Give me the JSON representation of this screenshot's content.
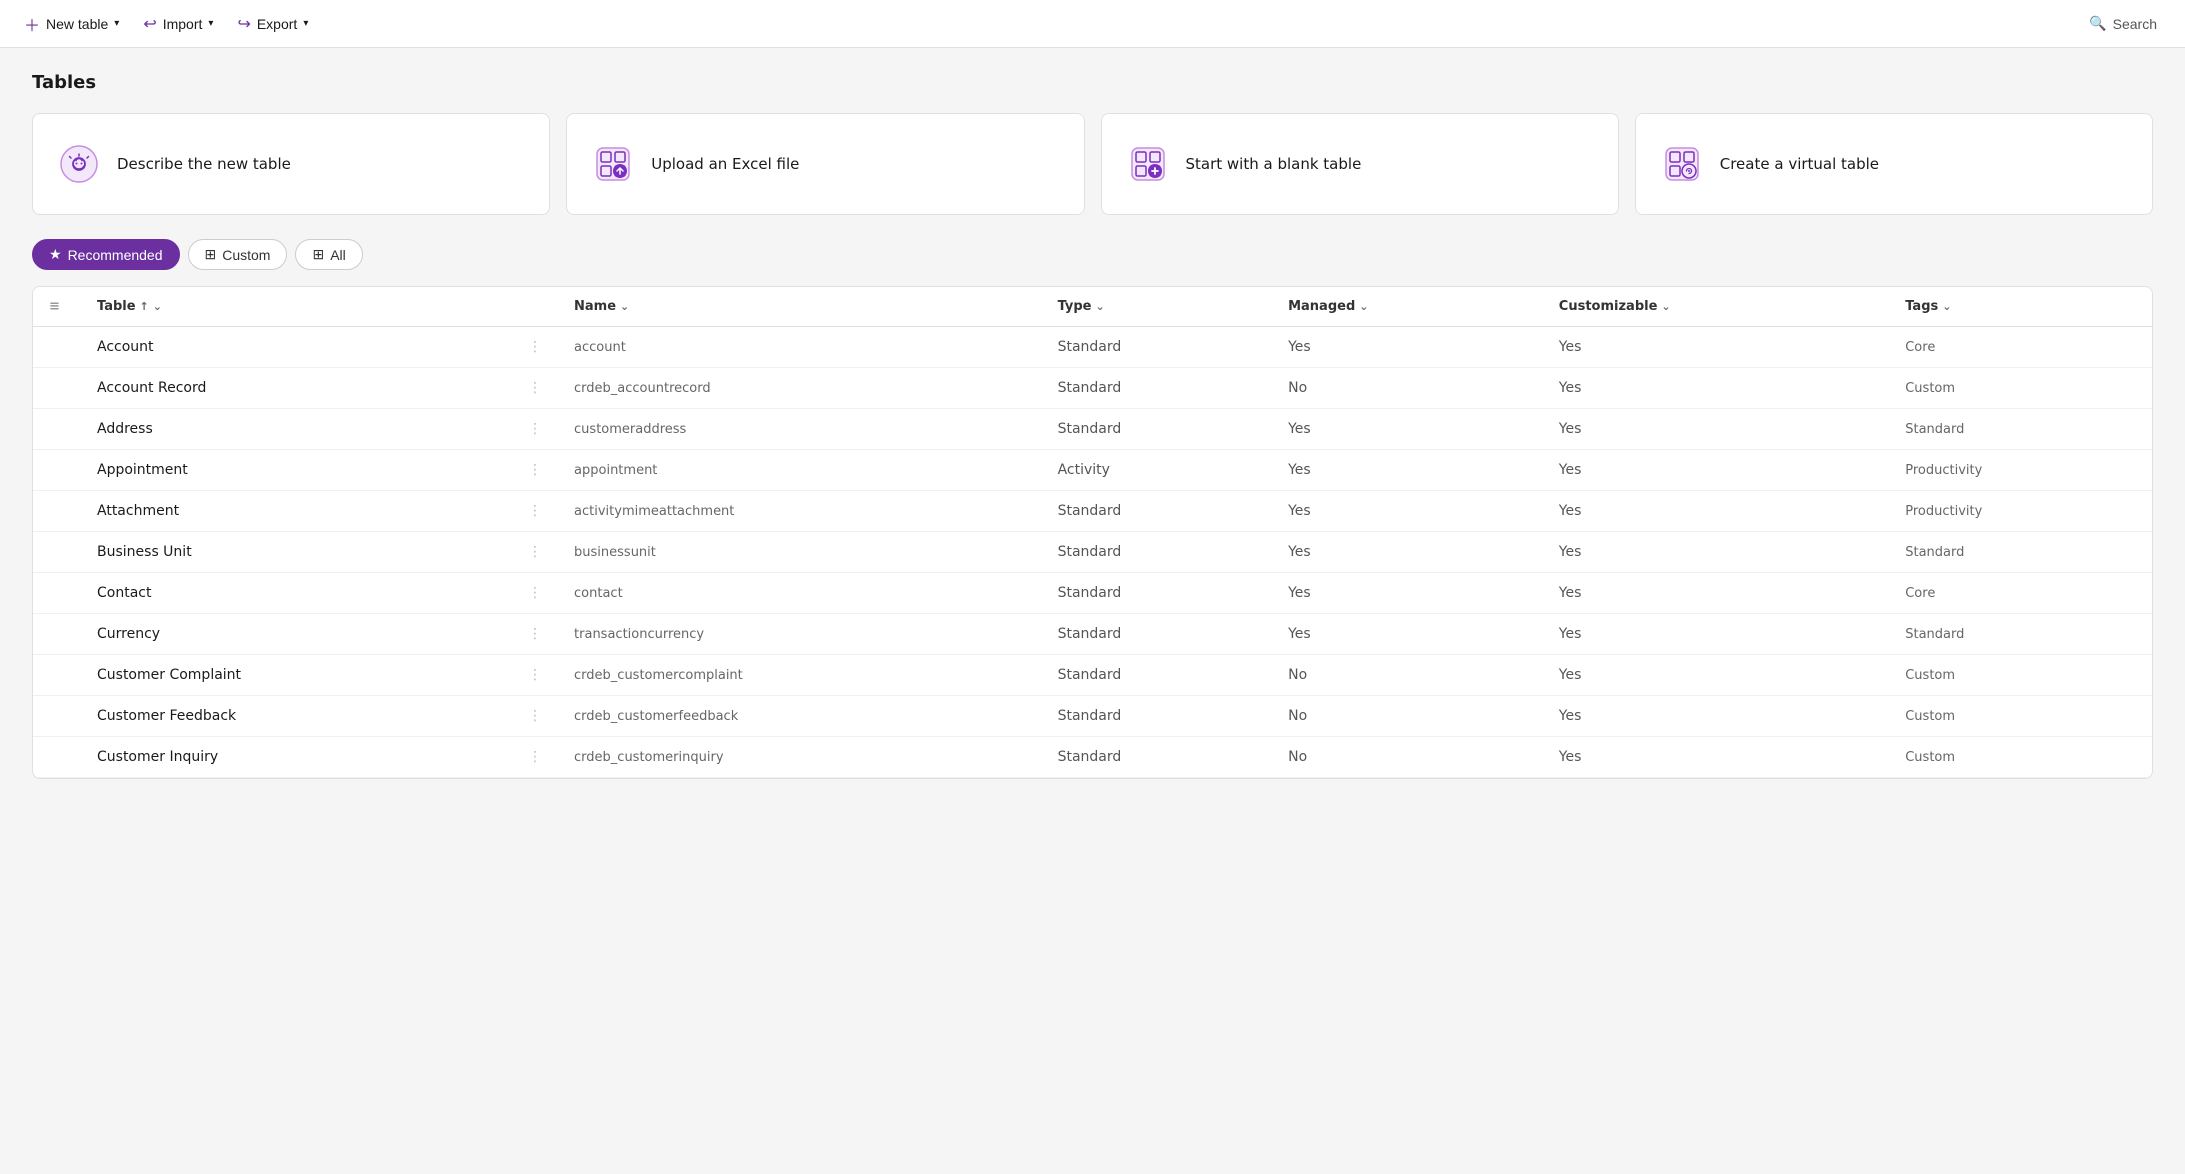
{
  "topbar": {
    "new_table_label": "New table",
    "import_label": "Import",
    "export_label": "Export",
    "search_label": "Search"
  },
  "page": {
    "title": "Tables"
  },
  "cards": [
    {
      "id": "describe",
      "label": "Describe the new table",
      "icon": "ai"
    },
    {
      "id": "upload",
      "label": "Upload an Excel file",
      "icon": "excel"
    },
    {
      "id": "blank",
      "label": "Start with a blank table",
      "icon": "blank"
    },
    {
      "id": "virtual",
      "label": "Create a virtual table",
      "icon": "virtual"
    }
  ],
  "filters": [
    {
      "id": "recommended",
      "label": "Recommended",
      "active": true
    },
    {
      "id": "custom",
      "label": "Custom",
      "active": false
    },
    {
      "id": "all",
      "label": "All",
      "active": false
    }
  ],
  "table": {
    "columns": [
      {
        "id": "table",
        "label": "Table",
        "sort": "asc"
      },
      {
        "id": "name",
        "label": "Name"
      },
      {
        "id": "type",
        "label": "Type"
      },
      {
        "id": "managed",
        "label": "Managed"
      },
      {
        "id": "customizable",
        "label": "Customizable"
      },
      {
        "id": "tags",
        "label": "Tags"
      }
    ],
    "rows": [
      {
        "table": "Account",
        "name": "account",
        "type": "Standard",
        "managed": "Yes",
        "customizable": "Yes",
        "tags": "Core"
      },
      {
        "table": "Account Record",
        "name": "crdeb_accountrecord",
        "type": "Standard",
        "managed": "No",
        "customizable": "Yes",
        "tags": "Custom"
      },
      {
        "table": "Address",
        "name": "customeraddress",
        "type": "Standard",
        "managed": "Yes",
        "customizable": "Yes",
        "tags": "Standard"
      },
      {
        "table": "Appointment",
        "name": "appointment",
        "type": "Activity",
        "managed": "Yes",
        "customizable": "Yes",
        "tags": "Productivity"
      },
      {
        "table": "Attachment",
        "name": "activitymimeattachment",
        "type": "Standard",
        "managed": "Yes",
        "customizable": "Yes",
        "tags": "Productivity"
      },
      {
        "table": "Business Unit",
        "name": "businessunit",
        "type": "Standard",
        "managed": "Yes",
        "customizable": "Yes",
        "tags": "Standard"
      },
      {
        "table": "Contact",
        "name": "contact",
        "type": "Standard",
        "managed": "Yes",
        "customizable": "Yes",
        "tags": "Core"
      },
      {
        "table": "Currency",
        "name": "transactioncurrency",
        "type": "Standard",
        "managed": "Yes",
        "customizable": "Yes",
        "tags": "Standard"
      },
      {
        "table": "Customer Complaint",
        "name": "crdeb_customercomplaint",
        "type": "Standard",
        "managed": "No",
        "customizable": "Yes",
        "tags": "Custom"
      },
      {
        "table": "Customer Feedback",
        "name": "crdeb_customerfeedback",
        "type": "Standard",
        "managed": "No",
        "customizable": "Yes",
        "tags": "Custom"
      },
      {
        "table": "Customer Inquiry",
        "name": "crdeb_customerinquiry",
        "type": "Standard",
        "managed": "No",
        "customizable": "Yes",
        "tags": "Custom"
      }
    ]
  },
  "colors": {
    "accent": "#6b2fa0"
  }
}
